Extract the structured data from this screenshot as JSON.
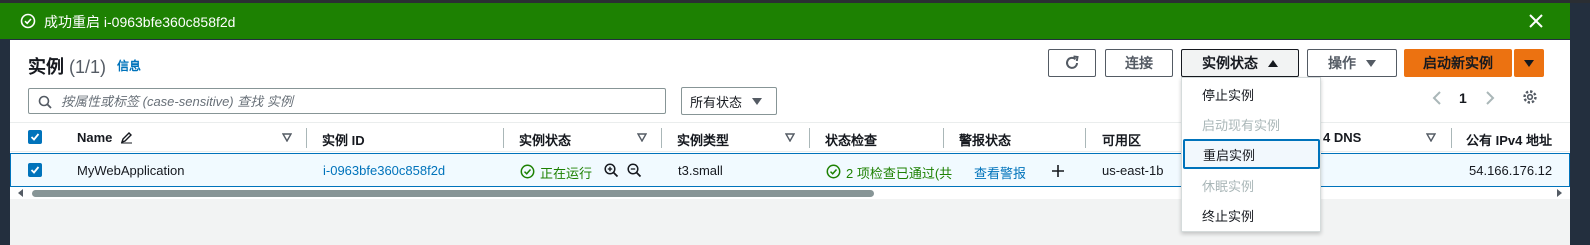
{
  "flash": {
    "message": "成功重启 i-0963bfe360c858f2d"
  },
  "header": {
    "title": "实例",
    "count": "(1/1)",
    "info_link": "信息"
  },
  "toolbar": {
    "connect_label": "连接",
    "instance_state_label": "实例状态",
    "actions_label": "操作",
    "launch_label": "启动新实例"
  },
  "filter": {
    "search_placeholder": "按属性或标签 (case-sensitive) 查找 实例",
    "status_select": "所有状态"
  },
  "pagination": {
    "page": "1"
  },
  "table": {
    "columns": [
      "Name",
      "实例 ID",
      "实例状态",
      "实例类型",
      "状态检查",
      "警报状态",
      "可用区",
      "4 DNS",
      "公有 IPv4 地址"
    ],
    "rows": [
      {
        "name": "MyWebApplication",
        "instance_id": "i-0963bfe360c858f2d",
        "state": "正在运行",
        "type": "t3.small",
        "status_check": "2 项检查已通过(共",
        "alarm_status": "查看警报",
        "az": "us-east-1b",
        "public_ip": "54.166.176.12"
      }
    ]
  },
  "instance_state_menu": {
    "items": [
      {
        "label": "停止实例",
        "enabled": true
      },
      {
        "label": "启动现有实例",
        "enabled": false
      },
      {
        "label": "重启实例",
        "enabled": true,
        "highlighted": true
      },
      {
        "label": "休眠实例",
        "enabled": false
      },
      {
        "label": "终止实例",
        "enabled": true
      }
    ]
  },
  "colors": {
    "success_banner": "#1d8102",
    "link": "#0073bb",
    "primary_button": "#ec7211",
    "header_bar": "#232f3e"
  }
}
